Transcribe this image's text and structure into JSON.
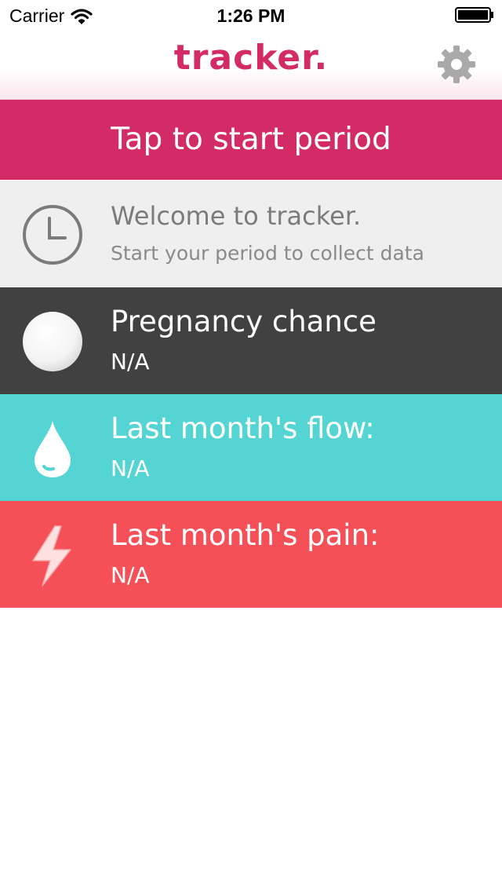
{
  "status_bar": {
    "carrier": "Carrier",
    "time": "1:26 PM"
  },
  "header": {
    "logo": "tracker."
  },
  "start_button": {
    "label": "Tap to start period"
  },
  "welcome": {
    "title": "Welcome to tracker.",
    "subtitle": "Start your period to collect data"
  },
  "pregnancy": {
    "title": "Pregnancy chance",
    "value": "N/A"
  },
  "flow": {
    "title": "Last month's flow:",
    "value": "N/A"
  },
  "pain": {
    "title": "Last month's pain:",
    "value": "N/A"
  },
  "colors": {
    "accent": "#d32b66",
    "welcome_bg": "#efefef",
    "pregnancy_bg": "#414141",
    "flow_bg": "#55d4d4",
    "pain_bg": "#f55058"
  },
  "icons": {
    "settings": "gear-icon",
    "welcome": "clock-icon",
    "pregnancy": "circle-icon",
    "flow": "droplet-icon",
    "pain": "lightning-icon"
  }
}
